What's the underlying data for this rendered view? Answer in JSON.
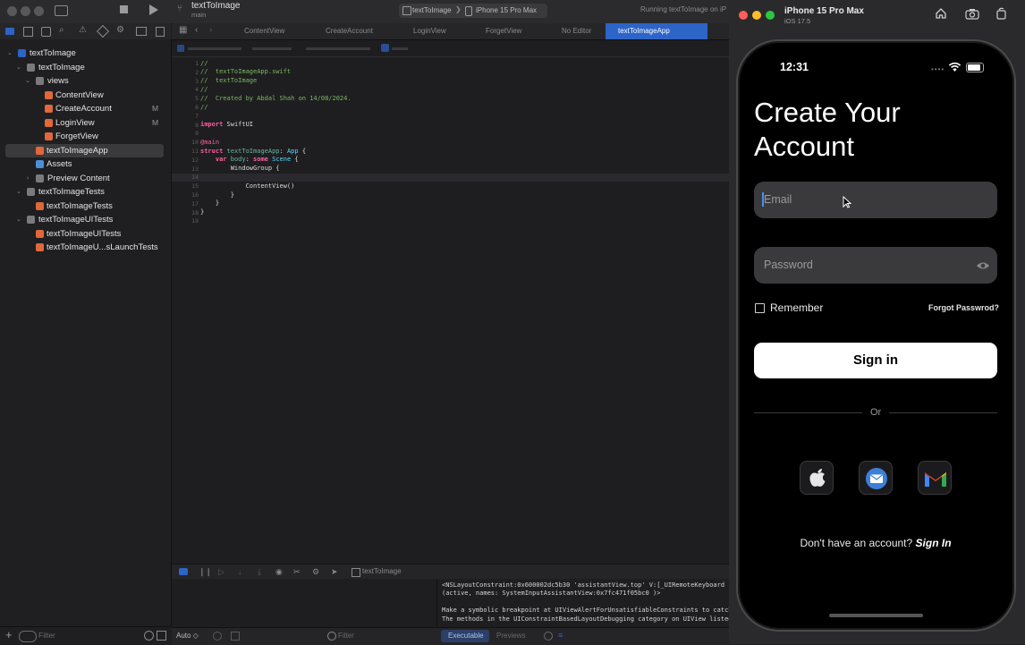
{
  "window": {
    "project_title": "textToImage",
    "branch": "main",
    "scheme": "textToImage",
    "destination": "iPhone 15 Pro Max",
    "status": "Running textToImage on iP"
  },
  "editor_tabs": [
    {
      "label": "ContentView"
    },
    {
      "label": "CreateAccount"
    },
    {
      "label": "LoginView"
    },
    {
      "label": "ForgetView"
    },
    {
      "label": "No Editor"
    },
    {
      "label": "textToImageApp"
    }
  ],
  "navigator": {
    "items": [
      {
        "label": "textToImage",
        "flag": ""
      },
      {
        "label": "textToImage",
        "flag": ""
      },
      {
        "label": "views",
        "flag": ""
      },
      {
        "label": "ContentView",
        "flag": ""
      },
      {
        "label": "CreateAccount",
        "flag": "M"
      },
      {
        "label": "LoginView",
        "flag": "M"
      },
      {
        "label": "ForgetView",
        "flag": ""
      },
      {
        "label": "textToImageApp",
        "flag": ""
      },
      {
        "label": "Assets",
        "flag": ""
      },
      {
        "label": "Preview Content",
        "flag": ""
      },
      {
        "label": "textToImageTests",
        "flag": ""
      },
      {
        "label": "textToImageTests",
        "flag": ""
      },
      {
        "label": "textToImageUITests",
        "flag": ""
      },
      {
        "label": "textToImageUITests",
        "flag": ""
      },
      {
        "label": "textToImageU...sLaunchTests",
        "flag": ""
      }
    ],
    "filter_placeholder": "Filter"
  },
  "code": {
    "line_numbers": [
      "1",
      "2",
      "3",
      "4",
      "5",
      "6",
      "7",
      "8",
      "9",
      "10",
      "11",
      "12",
      "13",
      "14",
      "15",
      "16",
      "17",
      "18",
      "19"
    ],
    "lines": [
      "//",
      "//  textToImageApp.swift",
      "//  textToImage",
      "//",
      "//  Created by Abdal Shah on 14/08/2024.",
      "//",
      "",
      "import SwiftUI",
      "",
      "@main",
      "struct textToImageApp: App {",
      "    var body: some Scene {",
      "        WindowGroup {",
      "",
      "            ContentView()",
      "        }",
      "    }",
      "}",
      ""
    ]
  },
  "debug": {
    "target": "textToImage",
    "console_lines": [
      "<NSLayoutConstraint:0x600002dc5b30 'assistantView.top' V:[_UIRemoteKeyboard",
      "(active, names: SystemInputAssistantView:0x7fc471f05bc0 )>",
      "",
      "Make a symbolic breakpoint at UIViewAlertForUnsatisfiableConstraints to catch",
      "The methods in the UIConstraintBasedLayoutDebugging category on UIView listed"
    ],
    "auto_label": "Auto ◇",
    "filter_placeholder": "Filter",
    "tab_executable": "Executable",
    "tab_previews": "Previews"
  },
  "simulator": {
    "device_name": "iPhone 15 Pro Max",
    "os": "iOS 17.5",
    "time": "12:31",
    "screen": {
      "title_line1": "Create Your",
      "title_line2": "Account",
      "email_placeholder": "Email",
      "password_placeholder": "Password",
      "remember_label": "Remember",
      "forgot_label": "Forgot Passwrod?",
      "signin_label": "Sign in",
      "or_label": "Or",
      "no_account_text": "Don't have an account?",
      "signin_link": "Sign In",
      "social_icons": [
        "apple-icon",
        "mail-icon",
        "gmail-icon"
      ]
    }
  },
  "colors": {
    "accent": "#2c64c8",
    "comment": "#7cb860",
    "keyword": "#fc5fa3",
    "type": "#5dd8ff"
  }
}
